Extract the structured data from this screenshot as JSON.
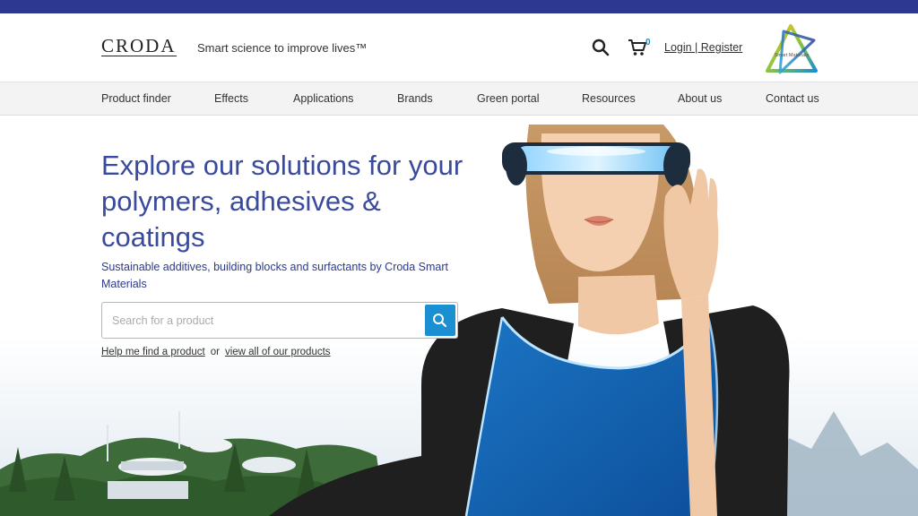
{
  "header": {
    "logo": "CRODA",
    "tagline": "Smart science to improve lives™",
    "cart_count": "0",
    "login_label": "Login | Register",
    "badge_text": "Smart Materials"
  },
  "nav": {
    "items": [
      "Product finder",
      "Effects",
      "Applications",
      "Brands",
      "Green portal",
      "Resources",
      "About us",
      "Contact us"
    ]
  },
  "hero": {
    "title": "Explore our solutions for your polymers, adhesives & coatings",
    "subtitle": "Sustainable additives, building blocks and surfactants by Croda Smart Materials",
    "search": {
      "placeholder": "Search for a product",
      "value": ""
    },
    "help_link": "Help me find a product",
    "or_text": "or",
    "view_all_link": "view all of our products"
  },
  "colors": {
    "brand_navy": "#2b3990",
    "accent_blue": "#1a8fd1",
    "nav_bg": "#f3f3f3"
  },
  "icons": [
    "search-icon",
    "cart-icon",
    "smart-materials-logo",
    "search-button-icon"
  ]
}
